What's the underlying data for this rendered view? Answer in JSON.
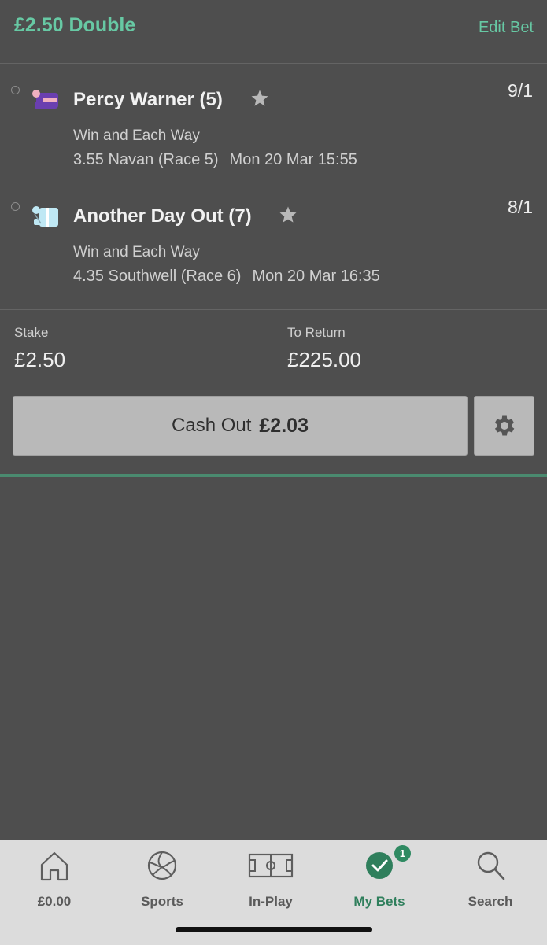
{
  "header": {
    "title": "£2.50 Double",
    "edit_label": "Edit Bet"
  },
  "selections": [
    {
      "runner": "Percy Warner (5)",
      "odds": "9/1",
      "bet_type": "Win and Each Way",
      "race": "3.55 Navan (Race 5)",
      "time": "Mon 20 Mar 15:55",
      "silk_colors": [
        "#6a3fb0",
        "#f0b0c0"
      ]
    },
    {
      "runner": "Another Day Out (7)",
      "odds": "8/1",
      "bet_type": "Win and Each Way",
      "race": "4.35 Southwell (Race 6)",
      "time": "Mon 20 Mar 16:35",
      "silk_colors": [
        "#bfe8f4",
        "#ffffff"
      ]
    }
  ],
  "summary": {
    "stake_label": "Stake",
    "stake_value": "£2.50",
    "return_label": "To Return",
    "return_value": "£225.00"
  },
  "cashout": {
    "label": "Cash Out",
    "amount": "£2.03"
  },
  "tabbar": {
    "items": [
      {
        "label": "£0.00",
        "icon": "home-icon"
      },
      {
        "label": "Sports",
        "icon": "football-icon"
      },
      {
        "label": "In-Play",
        "icon": "pitch-icon"
      },
      {
        "label": "My Bets",
        "icon": "check-circle-icon",
        "badge": "1",
        "active": true
      },
      {
        "label": "Search",
        "icon": "search-icon"
      }
    ]
  },
  "colors": {
    "accent": "#67c9a4",
    "active_tab": "#2f7f5c",
    "background": "#4e4e4e"
  }
}
